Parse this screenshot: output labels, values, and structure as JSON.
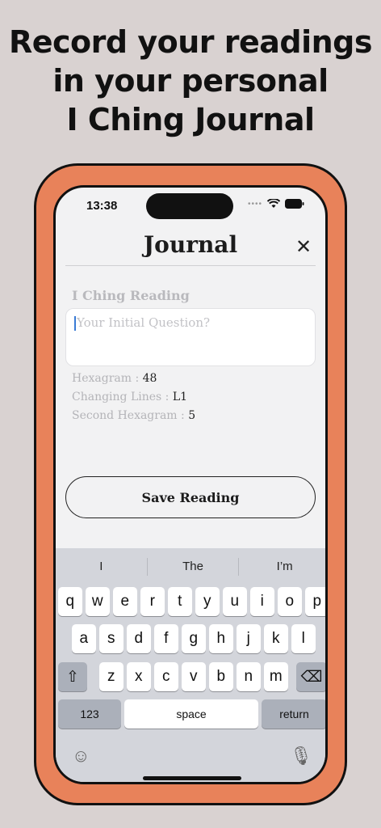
{
  "headline": [
    "Record your readings",
    "in your personal",
    "I Ching Journal"
  ],
  "status": {
    "time": "13:38"
  },
  "header": {
    "title": "Journal",
    "close": "✕"
  },
  "reading": {
    "section_label": "I Ching Reading",
    "question_placeholder": "Your Initial Question?",
    "hexagram_label": "Hexagram : ",
    "hexagram_value": "48",
    "changing_label": "Changing Lines  : ",
    "changing_value": "L1",
    "second_label": "Second Hexagram : ",
    "second_value": "5",
    "save_label": "Save Reading"
  },
  "keyboard": {
    "suggestions": [
      "I",
      "The",
      "I’m"
    ],
    "row1": [
      "q",
      "w",
      "e",
      "r",
      "t",
      "y",
      "u",
      "i",
      "o",
      "p"
    ],
    "row2": [
      "a",
      "s",
      "d",
      "f",
      "g",
      "h",
      "j",
      "k",
      "l"
    ],
    "row3": [
      "z",
      "x",
      "c",
      "v",
      "b",
      "n",
      "m"
    ],
    "numbers": "123",
    "space": "space",
    "return": "return"
  },
  "icons": {
    "shift": "⇧",
    "backspace": "⌫",
    "emoji": "☺",
    "mic": "🎙"
  }
}
